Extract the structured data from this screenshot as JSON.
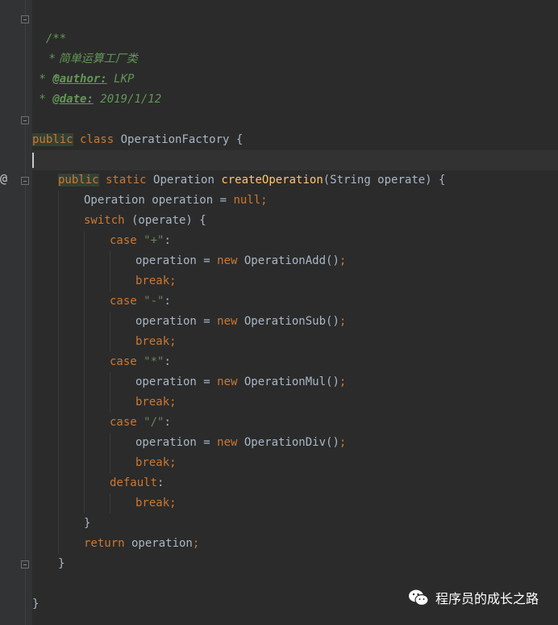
{
  "lines": {
    "l1": "/**",
    "l2": " * 简单运算工厂类",
    "l3": " *",
    "l4_star": " * ",
    "l4_tag": "@author:",
    "l4_val": " LKP",
    "l5_star": " * ",
    "l5_tag": "@date:",
    "l5_val": " 2019/1/12",
    "l6": " */",
    "l7_public": "public",
    "l7_class": " class",
    "l7_name": " OperationFactory {",
    "l9_public": "public",
    "l9_static": " static",
    "l9_type": " Operation ",
    "l9_fn": "createOperation",
    "l9_rest": "(String operate) {",
    "l10_a": "Operation operation = ",
    "l10_null": "null",
    "l10_semi": ";",
    "l11_switch": "switch",
    "l11_rest": " (operate) {",
    "case": "case",
    "plus": " \"+\"",
    "minus": " \"-\"",
    "mul": " \"*\"",
    "div": " \"/\"",
    "colon": ":",
    "assign": "operation = ",
    "new": "new",
    "add_ctor": " OperationAdd()",
    "sub_ctor": " OperationSub()",
    "mul_ctor": " OperationMul()",
    "div_ctor": " OperationDiv()",
    "semi": ";",
    "break": "break",
    "default": "default",
    "close_brace": "}",
    "return": "return",
    "return_rest": " operation",
    "gutter_mark": "@"
  },
  "watermark": {
    "text": "程序员的成长之路",
    "icon": "wechat-icon"
  }
}
